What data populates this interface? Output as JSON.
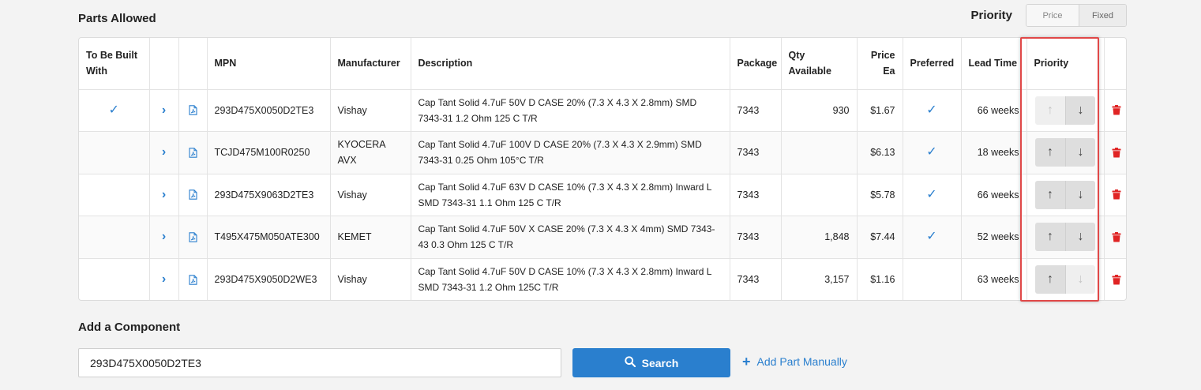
{
  "section": {
    "title": "Parts Allowed",
    "priority_label": "Priority",
    "priority_options": [
      "Price",
      "Fixed"
    ]
  },
  "table": {
    "headers": {
      "built_with": "To Be Built With",
      "mpn": "MPN",
      "manufacturer": "Manufacturer",
      "description": "Description",
      "package": "Package",
      "qty": "Qty Available",
      "price": "Price Ea",
      "preferred": "Preferred",
      "lead": "Lead Time",
      "priority": "Priority"
    },
    "rows": [
      {
        "built_with": true,
        "mpn": "293D475X0050D2TE3",
        "manufacturer": "Vishay",
        "description": "Cap Tant Solid 4.7uF 50V D CASE 20% (7.3 X 4.3 X 2.8mm) SMD 7343-31 1.2 Ohm 125 C T/R",
        "package": "7343",
        "qty": "930",
        "price": "$1.67",
        "preferred": true,
        "lead": "66 weeks",
        "up_enabled": false,
        "down_enabled": true
      },
      {
        "built_with": false,
        "mpn": "TCJD475M100R0250",
        "manufacturer": "KYOCERA AVX",
        "description": "Cap Tant Solid 4.7uF 100V D CASE 20% (7.3 X 4.3 X 2.9mm) SMD 7343-31 0.25 Ohm 105°C T/R",
        "package": "7343",
        "qty": "",
        "price": "$6.13",
        "preferred": true,
        "lead": "18 weeks",
        "up_enabled": true,
        "down_enabled": true
      },
      {
        "built_with": false,
        "mpn": "293D475X9063D2TE3",
        "manufacturer": "Vishay",
        "description": "Cap Tant Solid 4.7uF 63V D CASE 10% (7.3 X 4.3 X 2.8mm) Inward L SMD 7343-31 1.1 Ohm 125 C T/R",
        "package": "7343",
        "qty": "",
        "price": "$5.78",
        "preferred": true,
        "lead": "66 weeks",
        "up_enabled": true,
        "down_enabled": true
      },
      {
        "built_with": false,
        "mpn": "T495X475M050ATE300",
        "manufacturer": "KEMET",
        "description": "Cap Tant Solid 4.7uF 50V X CASE 20% (7.3 X 4.3 X 4mm) SMD 7343-43 0.3 Ohm 125 C T/R",
        "package": "7343",
        "qty": "1,848",
        "price": "$7.44",
        "preferred": true,
        "lead": "52 weeks",
        "up_enabled": true,
        "down_enabled": true
      },
      {
        "built_with": false,
        "mpn": "293D475X9050D2WE3",
        "manufacturer": "Vishay",
        "description": "Cap Tant Solid 4.7uF 50V D CASE 10% (7.3 X 4.3 X 2.8mm) Inward L SMD 7343-31 1.2 Ohm 125C T/R",
        "package": "7343",
        "qty": "3,157",
        "price": "$1.16",
        "preferred": false,
        "lead": "63 weeks",
        "up_enabled": true,
        "down_enabled": false
      }
    ]
  },
  "add_component": {
    "title": "Add a Component",
    "input_value": "293D475X0050D2TE3",
    "search_label": "Search",
    "add_manual_label": "Add Part Manually"
  },
  "colors": {
    "accent": "#2a7fce",
    "delete": "#e02424",
    "highlight": "#e04848"
  }
}
